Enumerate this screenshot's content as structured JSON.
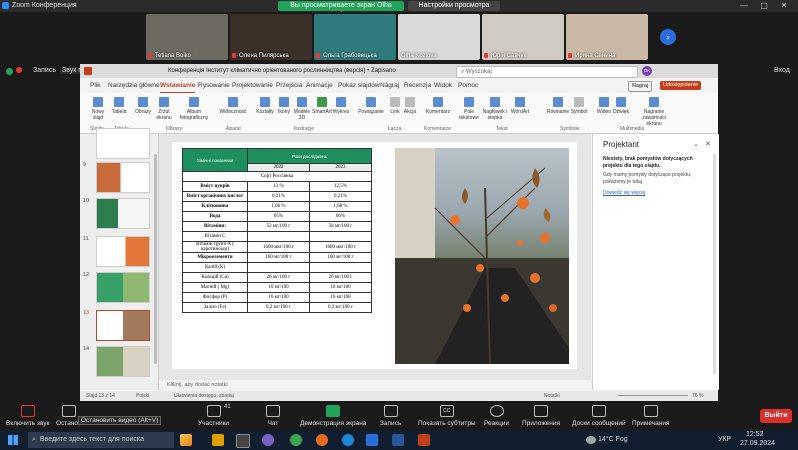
{
  "zoom": {
    "window_title": "Zoom Конференция",
    "share_banner": "Вы просматриваете экран Olha Kozlova",
    "view_settings": "Настройки просмотра",
    "win_buttons": [
      "—",
      "▢",
      "✕"
    ],
    "participants": [
      {
        "name": "Tetiana Boiko"
      },
      {
        "name": "Олена Пилярська"
      },
      {
        "name": "Ольга Грабовецька"
      },
      {
        "name": "Olha Kozlova"
      },
      {
        "name": "Юрій Савчук"
      },
      {
        "name": "Ирина Сенина"
      }
    ],
    "record_label": "Запись",
    "sound_tooltip": "Звук принуд. (Alt+A) — включ. звук",
    "view_label": "Вход",
    "bottom": {
      "sound": "Включить звук",
      "video": "Остановить видео (Alt+V)",
      "video_short": "Останов",
      "participants": "Участники",
      "participants_count": "41",
      "chat": "Чат",
      "share": "Демонстрация экрана",
      "record": "Запись",
      "captions": "Показать субтитры",
      "captions_badge": "CC",
      "reactions": "Реакции",
      "apps": "Приложения",
      "whiteboards": "Доски сообщений",
      "notes": "Примечания",
      "leave": "Выйти"
    }
  },
  "ppt": {
    "title": "Конференція Інститут кліматично орієнтованого рослинництва (версія) • Zapisano",
    "search_placeholder": "Wyszukaj",
    "user_badge": "OK",
    "record_btn": "Nagraj",
    "share_btn": "Udostępnianie",
    "tabs": [
      "Plik",
      "Narzędzia główne",
      "Wstawianie",
      "Rysowanie",
      "Projektowanie",
      "Przejścia",
      "Animacje",
      "Pokaz slajdów",
      "Nagraj",
      "Recenzja",
      "Widok",
      "Pomoc"
    ],
    "active_tab": "Wstawianie",
    "ribbon_buttons": [
      "Nowy slajd",
      "Tabela",
      "Obrazy",
      "Zrzut ekranu",
      "Album fotograficzny",
      "Widoczność",
      "Kształty",
      "Ikony",
      "Modele 3D",
      "SmartArt",
      "Wykres",
      "Powiązanie",
      "Link",
      "Akcja",
      "Komentarz",
      "Pole tekstowe",
      "Nagłówek i stopka",
      "WordArt",
      "Równanie",
      "Symbol",
      "Wideo",
      "Dźwięk",
      "Nagranie zawartości ekranu"
    ],
    "ribbon_groups": [
      "Slajdy",
      "Tabele",
      "Obrazy",
      "Aparat",
      "Ilustracje",
      "Łącza",
      "Komentarze",
      "Tekst",
      "Symbole",
      "Multimedia"
    ],
    "thumb_numbers": [
      "9",
      "10",
      "11",
      "12",
      "13",
      "14"
    ],
    "notes_placeholder": "Kliknij, aby dodać notatki",
    "status_left": "Slajd 13 z 14",
    "status_lang": "Polski",
    "status_accessibility": "Ułatwienia dostępu: zbadaj",
    "status_notes": "Notatki",
    "zoom_level": "76 %",
    "projektant": {
      "title": "Projektant",
      "msg_bold": "Niestety, brak pomysłów dotyczących projektu dla tego slajdu.",
      "msg": "Gdy mamy pomysły dotyczące projektu, pokażemy je tutaj.",
      "link": "Dowiedz się więcej"
    }
  },
  "table": {
    "header_col": "Хімічні показники",
    "header_years": "Роки досліджень",
    "year1": "2022",
    "year2": "2023",
    "variety": "Сорт Россіянка",
    "rows": [
      [
        "Вміст цукрів",
        "13 %",
        "12,5%"
      ],
      [
        "Вміст органічних кислот",
        "0,21%",
        "0,21%"
      ],
      [
        "Клітковина",
        "1,66 %",
        "1,68 %"
      ],
      [
        "Вода",
        "65%",
        "66%"
      ],
      [
        "Вітаміни:",
        "52 мг/100 г",
        "58 мг/100 г"
      ],
      [
        "Вітамін С",
        "",
        ""
      ],
      [
        "Вітамін групи А ( каротиноїди)",
        "1600 мкг/100 г",
        "1600 мкг/100 г"
      ],
      [
        "Мікроелементи",
        "160 мг/100 г",
        "160 мг/100 г"
      ],
      [
        "Калій (К)",
        "",
        ""
      ],
      [
        "Кальцій (Са)",
        "26 мг/100 г",
        "26 мг/100 г"
      ],
      [
        "Магній ( Mg)",
        "10 мг/100",
        "10 мг/100"
      ],
      [
        "Фосфор (Р)",
        "16 мг/100",
        "16 мг/100"
      ],
      [
        "Залізо (Fe)",
        "0,2 мг/100 г",
        "0,2 мг/100 г"
      ]
    ]
  },
  "taskbar": {
    "search_placeholder": "Введите здесь текст для поиска",
    "weather": "14°C Fog",
    "lang": "УКР",
    "time": "12:52",
    "date": "27.09.2024"
  },
  "colors": {
    "accent_green": "#22a35a",
    "ppt_accent": "#b7472a",
    "leave_red": "#d9302c",
    "table_header": "#1e8f5e"
  }
}
